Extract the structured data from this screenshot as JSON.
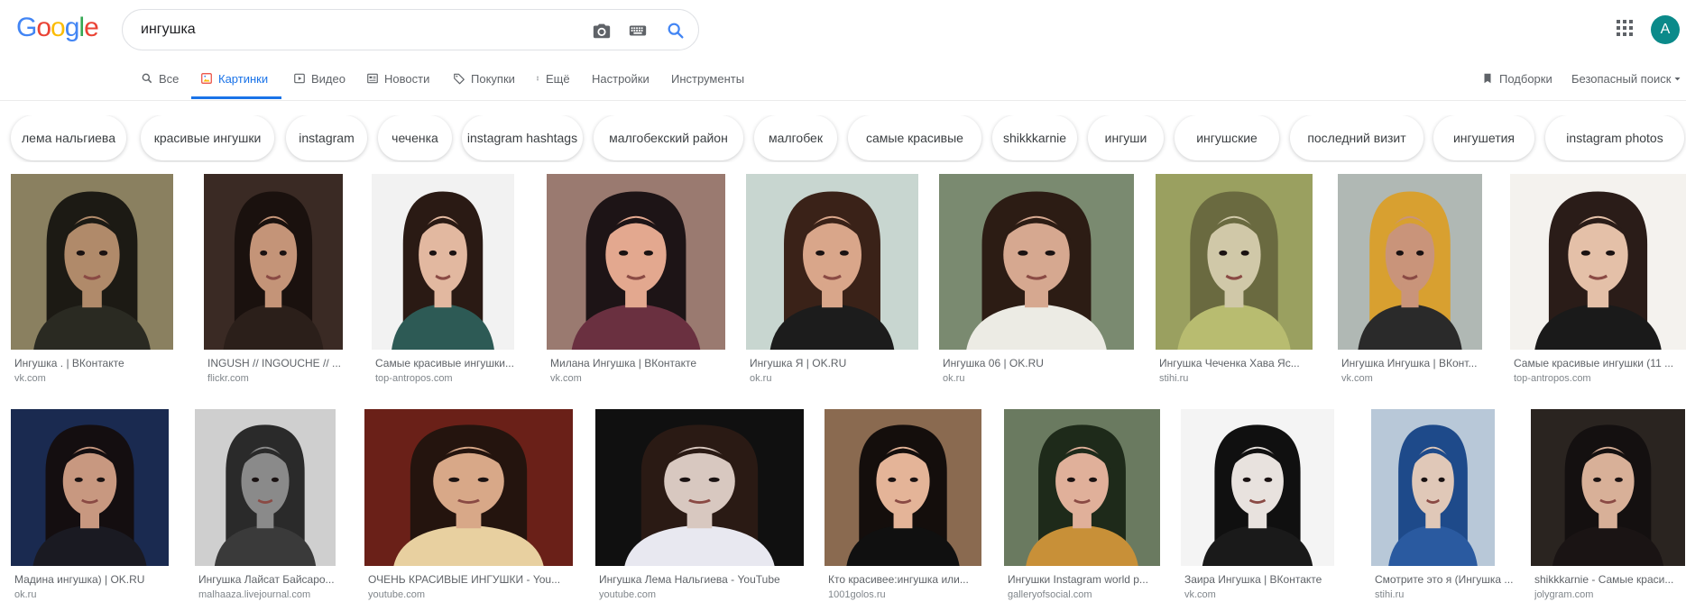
{
  "header": {
    "logo_letters": [
      {
        "ch": "G",
        "color": "#4285F4"
      },
      {
        "ch": "o",
        "color": "#EA4335"
      },
      {
        "ch": "o",
        "color": "#FBBC05"
      },
      {
        "ch": "g",
        "color": "#4285F4"
      },
      {
        "ch": "l",
        "color": "#34A853"
      },
      {
        "ch": "e",
        "color": "#EA4335"
      }
    ],
    "query": "ингушка",
    "avatar_letter": "A"
  },
  "tabs": {
    "all": "Все",
    "images": "Картинки",
    "video": "Видео",
    "news": "Новости",
    "shopping": "Покупки",
    "more": "Ещё",
    "settings": "Настройки",
    "tools": "Инструменты",
    "collections": "Подборки",
    "safesearch": "Безопасный поиск"
  },
  "chips": [
    "лема нальгиева",
    "красивые ингушки",
    "instagram",
    "чеченка",
    "instagram hashtags",
    "малгобекский район",
    "малгобек",
    "самые красивые",
    "shikkkarnie",
    "ингуши",
    "ингушские",
    "последний визит",
    "ингушетия",
    "instagram photos",
    "ingush"
  ],
  "results": [
    {
      "title": "Ингушка . | ВКонтакте",
      "source": "vk.com"
    },
    {
      "title": "INGUSH // INGOUCHE // ...",
      "source": "flickr.com"
    },
    {
      "title": "Самые красивые ингушки...",
      "source": "top-antropos.com"
    },
    {
      "title": "Милана Ингушка | ВКонтакте",
      "source": "vk.com"
    },
    {
      "title": "Ингушка Я | OK.RU",
      "source": "ok.ru"
    },
    {
      "title": "Ингушка 06 | OK.RU",
      "source": "ok.ru"
    },
    {
      "title": "Ингушка Чеченка Хава Яс...",
      "source": "stihi.ru"
    },
    {
      "title": "Ингушка Ингушка | ВКонт...",
      "source": "vk.com"
    },
    {
      "title": "Самые красивые ингушки (11 ...",
      "source": "top-antropos.com"
    },
    {
      "title": "Мадина ингушка) | OK.RU",
      "source": "ok.ru"
    },
    {
      "title": "Ингушка Лайсат Байсаро...",
      "source": "malhaaza.livejournal.com"
    },
    {
      "title": "ОЧЕНЬ КРАСИВЫЕ ИНГУШКИ - You...",
      "source": "youtube.com"
    },
    {
      "title": "Ингушка Лема Нальгиева - YouTube",
      "source": "youtube.com"
    },
    {
      "title": "Кто красивее:ингушка или...",
      "source": "1001golos.ru"
    },
    {
      "title": "Ингушки Instagram world p...",
      "source": "galleryofsocial.com"
    },
    {
      "title": "Заира Ингушка | ВКонтакте",
      "source": "vk.com"
    },
    {
      "title": "Смотрите это я (Ингушка ...",
      "source": "stihi.ru"
    },
    {
      "title": "shikkkarnie - Самые краси...",
      "source": "jolygram.com"
    }
  ],
  "thumb_palette": [
    {
      "bg": "#8a8060",
      "hair": "#1c1a14",
      "skin": "#b08a6a",
      "cloth": "#2a2a22"
    },
    {
      "bg": "#3a2a24",
      "hair": "#1a110e",
      "skin": "#c49478",
      "cloth": "#2b1f1a"
    },
    {
      "bg": "#f2f2f2",
      "hair": "#2a1a14",
      "skin": "#e2b8a0",
      "cloth": "#2d5a55"
    },
    {
      "bg": "#9a7a70",
      "hair": "#1d1416",
      "skin": "#e3a88f",
      "cloth": "#6a3040"
    },
    {
      "bg": "#c8d6d0",
      "hair": "#3a2218",
      "skin": "#d9a68a",
      "cloth": "#1c1c1c"
    },
    {
      "bg": "#7a8a70",
      "hair": "#2c1c14",
      "skin": "#d6a890",
      "cloth": "#ecebe4"
    },
    {
      "bg": "#9aa060",
      "hair": "#6a6a40",
      "skin": "#d0c8a8",
      "cloth": "#b8bc70"
    },
    {
      "bg": "#b0b8b4",
      "hair": "#d8a030",
      "skin": "#c9947a",
      "cloth": "#2a2a2a"
    },
    {
      "bg": "#f4f2ee",
      "hair": "#2a1c18",
      "skin": "#e4c0a8",
      "cloth": "#1a1a1a"
    },
    {
      "bg": "#1a2a50",
      "hair": "#140e10",
      "skin": "#c89880",
      "cloth": "#1a1a22"
    },
    {
      "bg": "#cfcfcf",
      "hair": "#2a2a2a",
      "skin": "#8a8a8a",
      "cloth": "#3a3a3a"
    },
    {
      "bg": "#6a2018",
      "hair": "#24140e",
      "skin": "#d8a888",
      "cloth": "#e8d0a0"
    },
    {
      "bg": "#101010",
      "hair": "#2a1a14",
      "skin": "#d8c8c0",
      "cloth": "#e8e8f0"
    },
    {
      "bg": "#8a6a50",
      "hair": "#140e0c",
      "skin": "#e4b498",
      "cloth": "#101010"
    },
    {
      "bg": "#6a7a60",
      "hair": "#1e2a1a",
      "skin": "#e0b09a",
      "cloth": "#c89038"
    },
    {
      "bg": "#f4f4f4",
      "hair": "#101010",
      "skin": "#e8e2de",
      "cloth": "#1a1a1a"
    },
    {
      "bg": "#b8c8d8",
      "hair": "#1e4a8a",
      "skin": "#e0c8b8",
      "cloth": "#2a5aa0"
    },
    {
      "bg": "#2a2420",
      "hair": "#141010",
      "skin": "#d8b098",
      "cloth": "#1a1414"
    }
  ]
}
